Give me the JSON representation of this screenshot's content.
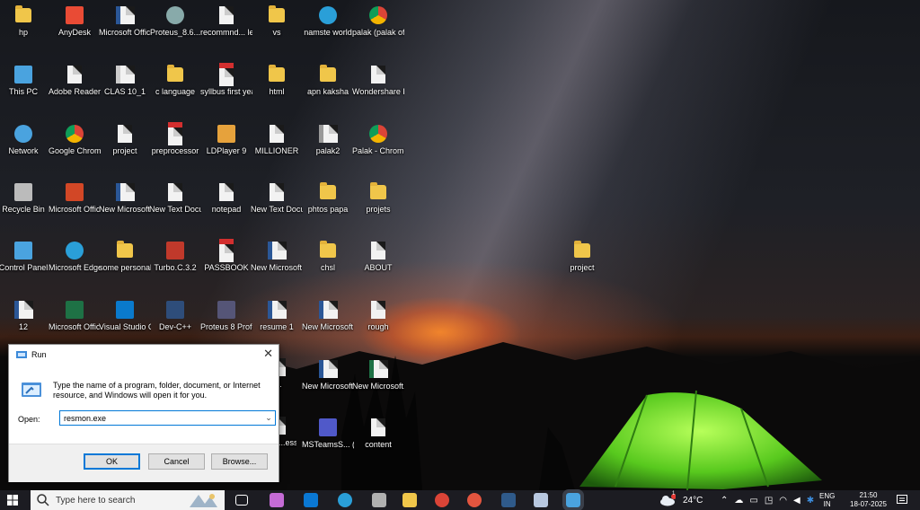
{
  "desktop": {
    "icons": [
      {
        "label": "hp",
        "kind": "folder-person",
        "color": "#f0c64a"
      },
      {
        "label": "AnyDesk",
        "kind": "app",
        "color": "#e94b35"
      },
      {
        "label": "Microsoft Office Wo...",
        "kind": "doc",
        "color": "#2b5797"
      },
      {
        "label": "Proteus_8.6...",
        "kind": "disc",
        "color": "#8aa"
      },
      {
        "label": "recommnd... letter",
        "kind": "doc",
        "color": "#f2f2f2"
      },
      {
        "label": "vs",
        "kind": "folder",
        "color": "#f0c64a"
      },
      {
        "label": "namste world",
        "kind": "edge",
        "color": "#2a9fd8"
      },
      {
        "label": "palak (palak office) - C...",
        "kind": "chrome",
        "color": "#db4437"
      },
      {
        "label": "This PC",
        "kind": "pc",
        "color": "#4aa3df"
      },
      {
        "label": "Adobe Reader XI",
        "kind": "doc",
        "color": "#f2f2f2"
      },
      {
        "label": "CLAS 10_1",
        "kind": "doc",
        "color": "#ccc"
      },
      {
        "label": "c language",
        "kind": "folder-doc",
        "color": "#f0c64a"
      },
      {
        "label": "syllbus first year",
        "kind": "pdf",
        "color": "#d32f2f"
      },
      {
        "label": "html",
        "kind": "folder-doc",
        "color": "#f0c64a"
      },
      {
        "label": "apn kaksha",
        "kind": "folder",
        "color": "#f0c64a"
      },
      {
        "label": "Wondershare Filmora 14",
        "kind": "doc",
        "color": "#f2f2f2"
      },
      {
        "label": "Network",
        "kind": "net",
        "color": "#4aa3df"
      },
      {
        "label": "Google Chrome",
        "kind": "chrome",
        "color": "#db4437"
      },
      {
        "label": "project",
        "kind": "doc",
        "color": "#f2f2f2"
      },
      {
        "label": "preprocessor",
        "kind": "pdf",
        "color": "#d32f2f"
      },
      {
        "label": "LDPlayer 9",
        "kind": "app",
        "color": "#e6a23c"
      },
      {
        "label": "MILLIONER",
        "kind": "doc",
        "color": "#f2f2f2"
      },
      {
        "label": "palak2",
        "kind": "doc",
        "color": "#999"
      },
      {
        "label": "Palak - Chrome",
        "kind": "chrome",
        "color": "#db4437"
      },
      {
        "label": "Recycle Bin",
        "kind": "bin",
        "color": "#bbb"
      },
      {
        "label": "Microsoft Office Po...",
        "kind": "app",
        "color": "#d24726"
      },
      {
        "label": "New Microsoft ...",
        "kind": "doc",
        "color": "#2b5797"
      },
      {
        "label": "New Text Docume...",
        "kind": "doc",
        "color": "#f2f2f2"
      },
      {
        "label": "notepad",
        "kind": "doc",
        "color": "#f2f2f2"
      },
      {
        "label": "New Text Docume...",
        "kind": "doc",
        "color": "#f2f2f2"
      },
      {
        "label": "phtos papa",
        "kind": "folder-doc",
        "color": "#f0c64a"
      },
      {
        "label": "projets",
        "kind": "folder",
        "color": "#f0c64a"
      },
      {
        "label": "Control Panel",
        "kind": "pc",
        "color": "#4aa3df"
      },
      {
        "label": "Microsoft Edge",
        "kind": "edge",
        "color": "#2a9fd8"
      },
      {
        "label": "some personal",
        "kind": "folder-doc",
        "color": "#f0c64a"
      },
      {
        "label": "Turbo.C.3.2",
        "kind": "app",
        "color": "#c0392b"
      },
      {
        "label": "PASSBOOK",
        "kind": "pdf",
        "color": "#d32f2f"
      },
      {
        "label": "New Microsoft ...",
        "kind": "doc",
        "color": "#2b5797"
      },
      {
        "label": "chsl",
        "kind": "folder",
        "color": "#f0c64a"
      },
      {
        "label": "ABOUT",
        "kind": "doc",
        "color": "#f2f2f2"
      },
      {
        "label": "12",
        "kind": "doc",
        "color": "#2b5797"
      },
      {
        "label": "Microsoft Office Exc...",
        "kind": "app",
        "color": "#1e7145"
      },
      {
        "label": "Visual Studio Code",
        "kind": "app",
        "color": "#0a7acc"
      },
      {
        "label": "Dev-C++",
        "kind": "app",
        "color": "#2e4d7a"
      },
      {
        "label": "Proteus 8 Professional",
        "kind": "app",
        "color": "#557"
      },
      {
        "label": "resume 1",
        "kind": "doc",
        "color": "#2b5797"
      },
      {
        "label": "New Microsoft ...",
        "kind": "doc",
        "color": "#2b5797"
      },
      {
        "label": "rough",
        "kind": "doc",
        "color": "#f2f2f2"
      },
      {
        "label": "New Microsoft ...",
        "kind": "doc",
        "color": "#2b5797"
      },
      {
        "label": "New Microsoft...",
        "kind": "doc",
        "color": "#1e7145"
      },
      {
        "label": "MSTeamsS... (1)",
        "kind": "app",
        "color": "#5059c9"
      },
      {
        "label": "content",
        "kind": "doc",
        "color": "#f2f2f2"
      },
      {
        "label": "project",
        "kind": "folder",
        "color": "#f0c64a"
      }
    ],
    "partial_labels": [
      "...",
      "...",
      "...nd ...ess"
    ]
  },
  "run_dialog": {
    "title": "Run",
    "close_glyph": "✕",
    "description": "Type the name of a program, folder, document, or Internet resource, and Windows will open it for you.",
    "open_label": "Open:",
    "open_value": "resmon.exe",
    "ok_label": "OK",
    "cancel_label": "Cancel",
    "browse_label": "Browse..."
  },
  "taskbar": {
    "search_placeholder": "Type here to search",
    "weather_temp": "24°C",
    "language_line1": "ENG",
    "language_line2": "IN",
    "time": "21:50",
    "date": "18-07-2025",
    "notification_badge": "1",
    "pinned": [
      {
        "name": "task-view-icon",
        "color": "#ffffff"
      },
      {
        "name": "copilot-icon",
        "color": "#c56bd6"
      },
      {
        "name": "outlook-icon",
        "color": "#0a78d4"
      },
      {
        "name": "edge-icon",
        "color": "#2a9fd8"
      },
      {
        "name": "game-icon",
        "color": "#b0b0b0"
      },
      {
        "name": "file-explorer-icon",
        "color": "#f0c64a"
      },
      {
        "name": "chrome-icon",
        "color": "#db4437"
      },
      {
        "name": "chrome-profile-icon",
        "color": "#e3553f"
      },
      {
        "name": "app-icon",
        "color": "#2f5a8a"
      },
      {
        "name": "document-app-icon",
        "color": "#b8c8e0"
      },
      {
        "name": "run-app-icon",
        "color": "#4aa3df"
      }
    ]
  }
}
